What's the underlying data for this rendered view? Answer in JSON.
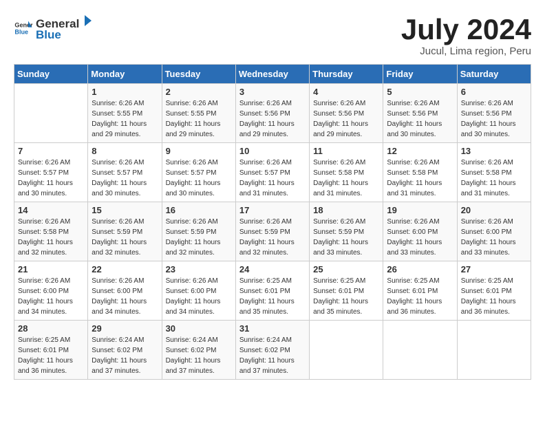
{
  "logo": {
    "general": "General",
    "blue": "Blue"
  },
  "title": "July 2024",
  "subtitle": "Jucul, Lima region, Peru",
  "weekdays": [
    "Sunday",
    "Monday",
    "Tuesday",
    "Wednesday",
    "Thursday",
    "Friday",
    "Saturday"
  ],
  "weeks": [
    [
      {
        "day": "",
        "info": ""
      },
      {
        "day": "1",
        "info": "Sunrise: 6:26 AM\nSunset: 5:55 PM\nDaylight: 11 hours\nand 29 minutes."
      },
      {
        "day": "2",
        "info": "Sunrise: 6:26 AM\nSunset: 5:55 PM\nDaylight: 11 hours\nand 29 minutes."
      },
      {
        "day": "3",
        "info": "Sunrise: 6:26 AM\nSunset: 5:56 PM\nDaylight: 11 hours\nand 29 minutes."
      },
      {
        "day": "4",
        "info": "Sunrise: 6:26 AM\nSunset: 5:56 PM\nDaylight: 11 hours\nand 29 minutes."
      },
      {
        "day": "5",
        "info": "Sunrise: 6:26 AM\nSunset: 5:56 PM\nDaylight: 11 hours\nand 30 minutes."
      },
      {
        "day": "6",
        "info": "Sunrise: 6:26 AM\nSunset: 5:56 PM\nDaylight: 11 hours\nand 30 minutes."
      }
    ],
    [
      {
        "day": "7",
        "info": "Sunrise: 6:26 AM\nSunset: 5:57 PM\nDaylight: 11 hours\nand 30 minutes."
      },
      {
        "day": "8",
        "info": "Sunrise: 6:26 AM\nSunset: 5:57 PM\nDaylight: 11 hours\nand 30 minutes."
      },
      {
        "day": "9",
        "info": "Sunrise: 6:26 AM\nSunset: 5:57 PM\nDaylight: 11 hours\nand 30 minutes."
      },
      {
        "day": "10",
        "info": "Sunrise: 6:26 AM\nSunset: 5:57 PM\nDaylight: 11 hours\nand 31 minutes."
      },
      {
        "day": "11",
        "info": "Sunrise: 6:26 AM\nSunset: 5:58 PM\nDaylight: 11 hours\nand 31 minutes."
      },
      {
        "day": "12",
        "info": "Sunrise: 6:26 AM\nSunset: 5:58 PM\nDaylight: 11 hours\nand 31 minutes."
      },
      {
        "day": "13",
        "info": "Sunrise: 6:26 AM\nSunset: 5:58 PM\nDaylight: 11 hours\nand 31 minutes."
      }
    ],
    [
      {
        "day": "14",
        "info": "Sunrise: 6:26 AM\nSunset: 5:58 PM\nDaylight: 11 hours\nand 32 minutes."
      },
      {
        "day": "15",
        "info": "Sunrise: 6:26 AM\nSunset: 5:59 PM\nDaylight: 11 hours\nand 32 minutes."
      },
      {
        "day": "16",
        "info": "Sunrise: 6:26 AM\nSunset: 5:59 PM\nDaylight: 11 hours\nand 32 minutes."
      },
      {
        "day": "17",
        "info": "Sunrise: 6:26 AM\nSunset: 5:59 PM\nDaylight: 11 hours\nand 32 minutes."
      },
      {
        "day": "18",
        "info": "Sunrise: 6:26 AM\nSunset: 5:59 PM\nDaylight: 11 hours\nand 33 minutes."
      },
      {
        "day": "19",
        "info": "Sunrise: 6:26 AM\nSunset: 6:00 PM\nDaylight: 11 hours\nand 33 minutes."
      },
      {
        "day": "20",
        "info": "Sunrise: 6:26 AM\nSunset: 6:00 PM\nDaylight: 11 hours\nand 33 minutes."
      }
    ],
    [
      {
        "day": "21",
        "info": "Sunrise: 6:26 AM\nSunset: 6:00 PM\nDaylight: 11 hours\nand 34 minutes."
      },
      {
        "day": "22",
        "info": "Sunrise: 6:26 AM\nSunset: 6:00 PM\nDaylight: 11 hours\nand 34 minutes."
      },
      {
        "day": "23",
        "info": "Sunrise: 6:26 AM\nSunset: 6:00 PM\nDaylight: 11 hours\nand 34 minutes."
      },
      {
        "day": "24",
        "info": "Sunrise: 6:25 AM\nSunset: 6:01 PM\nDaylight: 11 hours\nand 35 minutes."
      },
      {
        "day": "25",
        "info": "Sunrise: 6:25 AM\nSunset: 6:01 PM\nDaylight: 11 hours\nand 35 minutes."
      },
      {
        "day": "26",
        "info": "Sunrise: 6:25 AM\nSunset: 6:01 PM\nDaylight: 11 hours\nand 36 minutes."
      },
      {
        "day": "27",
        "info": "Sunrise: 6:25 AM\nSunset: 6:01 PM\nDaylight: 11 hours\nand 36 minutes."
      }
    ],
    [
      {
        "day": "28",
        "info": "Sunrise: 6:25 AM\nSunset: 6:01 PM\nDaylight: 11 hours\nand 36 minutes."
      },
      {
        "day": "29",
        "info": "Sunrise: 6:24 AM\nSunset: 6:02 PM\nDaylight: 11 hours\nand 37 minutes."
      },
      {
        "day": "30",
        "info": "Sunrise: 6:24 AM\nSunset: 6:02 PM\nDaylight: 11 hours\nand 37 minutes."
      },
      {
        "day": "31",
        "info": "Sunrise: 6:24 AM\nSunset: 6:02 PM\nDaylight: 11 hours\nand 37 minutes."
      },
      {
        "day": "",
        "info": ""
      },
      {
        "day": "",
        "info": ""
      },
      {
        "day": "",
        "info": ""
      }
    ]
  ]
}
